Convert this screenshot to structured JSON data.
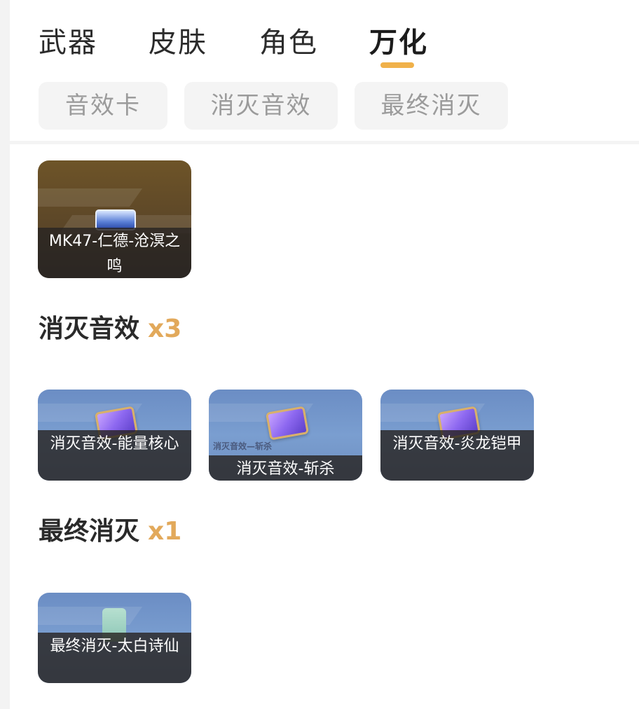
{
  "tabs": [
    {
      "label": "武器",
      "active": false
    },
    {
      "label": "皮肤",
      "active": false
    },
    {
      "label": "角色",
      "active": false
    },
    {
      "label": "万化",
      "active": true
    }
  ],
  "filters": [
    "音效卡",
    "消灭音效",
    "最终消灭"
  ],
  "accent_color": "#f0b14a",
  "count_color": "#e2a95b",
  "sections": {
    "top_card": {
      "caption": "MK47-仁德-沧溟之鸣"
    },
    "elimination_sounds": {
      "title": "消灭音效",
      "count": "x3",
      "cards": [
        {
          "caption": "消灭音效-能量核心"
        },
        {
          "caption": "消灭音效-斩杀",
          "image_text": "消灭音效—斩杀"
        },
        {
          "caption": "消灭音效-炎龙铠甲"
        }
      ]
    },
    "final_elimination": {
      "title": "最终消灭",
      "count": "x1",
      "cards": [
        {
          "caption": "最终消灭-太白诗仙"
        }
      ]
    }
  }
}
